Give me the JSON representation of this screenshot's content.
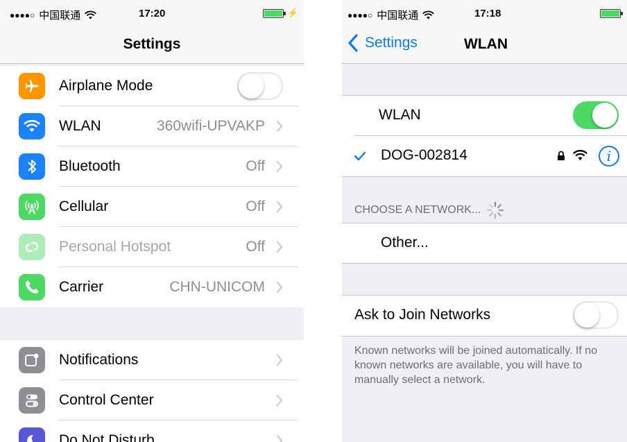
{
  "left": {
    "status": {
      "signal": "●●●●○",
      "carrier": "中国联通",
      "time": "17:20"
    },
    "nav": {
      "title": "Settings"
    },
    "group1": [
      {
        "id": "airplane",
        "label": "Airplane Mode",
        "value": "",
        "icon": "airplane-icon",
        "color": "#ff9500",
        "toggle": "off"
      },
      {
        "id": "wlan",
        "label": "WLAN",
        "value": "360wifi-UPVAKP",
        "icon": "wifi-icon",
        "color": "#1a82fb"
      },
      {
        "id": "bluetooth",
        "label": "Bluetooth",
        "value": "Off",
        "icon": "bluetooth-icon",
        "color": "#1a82fb"
      },
      {
        "id": "cellular",
        "label": "Cellular",
        "value": "Off",
        "icon": "cellular-icon",
        "color": "#4cd964"
      },
      {
        "id": "hotspot",
        "label": "Personal Hotspot",
        "value": "Off",
        "icon": "hotspot-icon",
        "color": "#4cd964",
        "dimmed": true
      },
      {
        "id": "carrier",
        "label": "Carrier",
        "value": "CHN-UNICOM",
        "icon": "phone-icon",
        "color": "#4cd964"
      }
    ],
    "group2": [
      {
        "id": "notifications",
        "label": "Notifications",
        "value": "",
        "icon": "notifications-icon",
        "color": "#8e8e93"
      },
      {
        "id": "control-center",
        "label": "Control Center",
        "value": "",
        "icon": "control-center-icon",
        "color": "#8e8e93"
      },
      {
        "id": "dnd",
        "label": "Do Not Disturb",
        "value": "",
        "icon": "moon-icon",
        "color": "#5856d6"
      }
    ]
  },
  "right": {
    "status": {
      "signal": "●●●●○",
      "carrier": "中国联通",
      "time": "17:18"
    },
    "nav": {
      "back": "Settings",
      "title": "WLAN"
    },
    "wlan_label": "WLAN",
    "wlan_toggle": "on",
    "connected_network": "DOG-002814",
    "choose_header": "CHOOSE A NETWORK...",
    "other_label": "Other...",
    "ask_label": "Ask to Join Networks",
    "ask_toggle": "off",
    "ask_footer": "Known networks will be joined automatically. If no known networks are available, you will have to manually select a network."
  },
  "colors": {
    "accent": "#0a7aff",
    "toggle_on": "#4cd964"
  }
}
